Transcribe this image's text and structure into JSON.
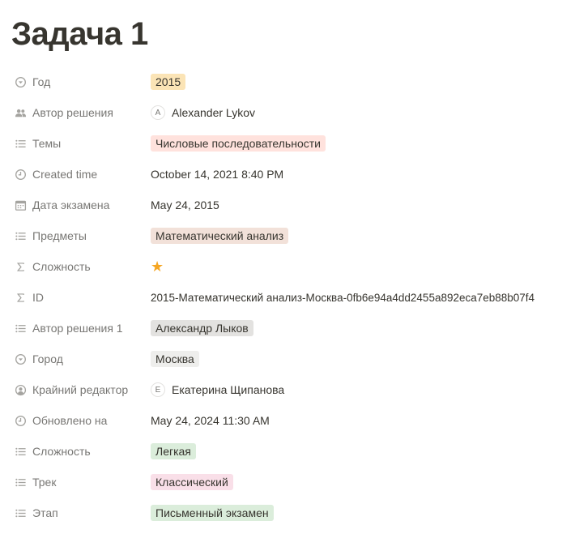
{
  "page": {
    "title": "Задача 1"
  },
  "colors": {
    "tag_yellow": "#fbe4b6",
    "tag_red": "#ffe2dd",
    "tag_brown": "#f2e1d9",
    "tag_gray": "#e3e2e0",
    "tag_lightgray": "#eeeeec",
    "tag_green": "#dbeddb",
    "tag_pink": "#f9dfe8",
    "star": "#f5a623"
  },
  "props": {
    "year": {
      "label": "Год",
      "icon": "select-icon",
      "value": "2015"
    },
    "solution_author": {
      "label": "Автор решения",
      "icon": "people-icon",
      "avatar": "A",
      "value": "Alexander Lykov"
    },
    "topics": {
      "label": "Темы",
      "icon": "multiselect-icon",
      "value": "Числовые последовательности"
    },
    "created_time": {
      "label": "Created time",
      "icon": "clock-icon",
      "value": "October 14, 2021 8:40 PM"
    },
    "exam_date": {
      "label": "Дата экзамена",
      "icon": "calendar-icon",
      "value": "May 24, 2015"
    },
    "subjects": {
      "label": "Предметы",
      "icon": "multiselect-icon",
      "value": "Математический анализ"
    },
    "difficulty_formula": {
      "label": "Сложность",
      "icon": "sigma-icon",
      "value": "★"
    },
    "id": {
      "label": "ID",
      "icon": "sigma-icon",
      "value": "2015-Математический анализ-Москва-0fb6e94a4dd2455a892eca7eb88b07f4"
    },
    "solution_author_1": {
      "label": "Автор решения 1",
      "icon": "multiselect-icon",
      "value": "Александр Лыков"
    },
    "city": {
      "label": "Город",
      "icon": "select-icon",
      "value": "Москва"
    },
    "last_editor": {
      "label": "Крайний редактор",
      "icon": "person-icon",
      "avatar": "E",
      "value": "Екатерина Щипанова"
    },
    "updated_at": {
      "label": "Обновлено на",
      "icon": "clock-icon",
      "value": "May 24, 2024 11:30 AM"
    },
    "difficulty": {
      "label": "Сложность",
      "icon": "multiselect-icon",
      "value": "Легкая"
    },
    "track": {
      "label": "Трек",
      "icon": "multiselect-icon",
      "value": "Классический"
    },
    "stage": {
      "label": "Этап",
      "icon": "multiselect-icon",
      "value": "Письменный экзамен"
    }
  }
}
